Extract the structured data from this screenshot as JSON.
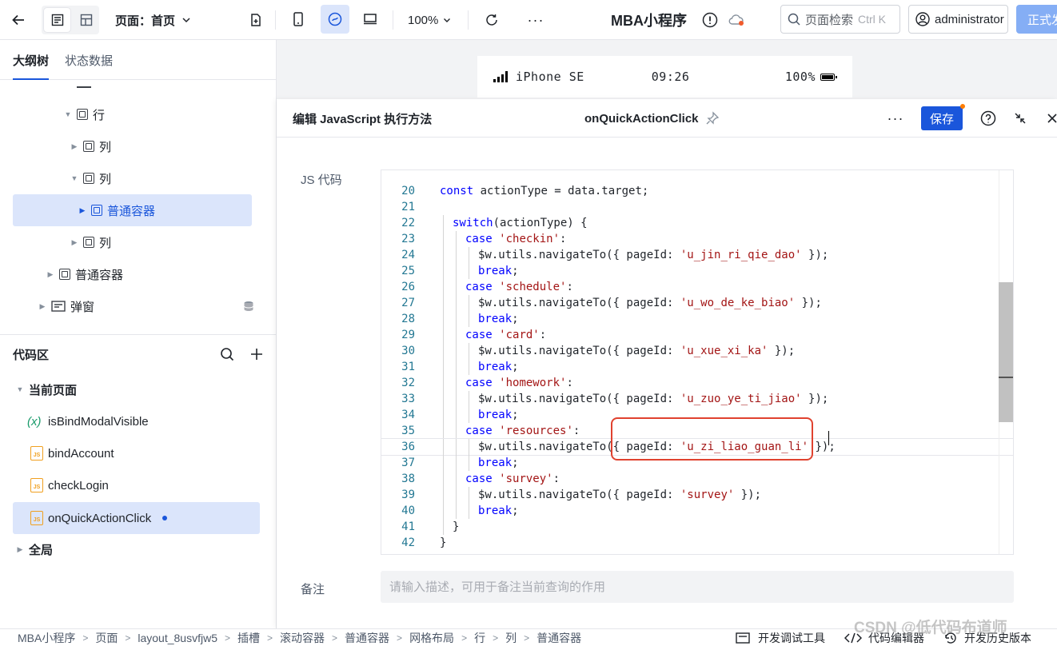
{
  "topbar": {
    "page_selector": "页面：首页",
    "zoom": "100%",
    "app_title": "MBA小程序",
    "search_label": "页面检索",
    "search_shortcut": "Ctrl K",
    "user": "administrator",
    "publish_label": "正式发"
  },
  "left_panel": {
    "tabs": [
      "大纲树",
      "状态数据"
    ],
    "tree": [
      {
        "label": "行"
      },
      {
        "label": "列"
      },
      {
        "label": "列"
      },
      {
        "label": "普通容器"
      },
      {
        "label": "列"
      },
      {
        "label": "普通容器"
      },
      {
        "label": "弹窗"
      }
    ],
    "code_area_title": "代码区",
    "current_page_label": "当前页面",
    "code_items": [
      "isBindModalVisible",
      "bindAccount",
      "checkLogin",
      "onQuickActionClick"
    ],
    "global_label": "全局"
  },
  "phone": {
    "device": "iPhone SE",
    "time": "09:26",
    "battery": "100%"
  },
  "editor": {
    "title": "编辑 JavaScript 执行方法",
    "function_name": "onQuickActionClick",
    "save_label": "保存",
    "code_label": "JS 代码",
    "note_label": "备注",
    "note_placeholder": "请输入描述，可用于备注当前查询的作用",
    "code": [
      {
        "n": "20",
        "indent": 0,
        "html": "<span class=\"kw\">const</span> actionType = data.target;"
      },
      {
        "n": "21",
        "indent": 0,
        "html": ""
      },
      {
        "n": "22",
        "indent": 1,
        "html": "<span class=\"kw\">switch</span>(actionType) {"
      },
      {
        "n": "23",
        "indent": 2,
        "html": "<span class=\"kw\">case</span> <span class=\"str\">'checkin'</span>:"
      },
      {
        "n": "24",
        "indent": 3,
        "html": "$w.utils.navigateTo({ pageId: <span class=\"str\">'u_jin_ri_qie_dao'</span> });"
      },
      {
        "n": "25",
        "indent": 3,
        "html": "<span class=\"kw\">break</span>;"
      },
      {
        "n": "26",
        "indent": 2,
        "html": "<span class=\"kw\">case</span> <span class=\"str\">'schedule'</span>:"
      },
      {
        "n": "27",
        "indent": 3,
        "html": "$w.utils.navigateTo({ pageId: <span class=\"str\">'u_wo_de_ke_biao'</span> });"
      },
      {
        "n": "28",
        "indent": 3,
        "html": "<span class=\"kw\">break</span>;"
      },
      {
        "n": "29",
        "indent": 2,
        "html": "<span class=\"kw\">case</span> <span class=\"str\">'card'</span>:"
      },
      {
        "n": "30",
        "indent": 3,
        "html": "$w.utils.navigateTo({ pageId: <span class=\"str\">'u_xue_xi_ka'</span> });"
      },
      {
        "n": "31",
        "indent": 3,
        "html": "<span class=\"kw\">break</span>;"
      },
      {
        "n": "32",
        "indent": 2,
        "html": "<span class=\"kw\">case</span> <span class=\"str\">'homework'</span>:"
      },
      {
        "n": "33",
        "indent": 3,
        "html": "$w.utils.navigateTo({ pageId: <span class=\"str\">'u_zuo_ye_ti_jiao'</span> });"
      },
      {
        "n": "34",
        "indent": 3,
        "html": "<span class=\"kw\">break</span>;"
      },
      {
        "n": "35",
        "indent": 2,
        "html": "<span class=\"kw\">case</span> <span class=\"str\">'resources'</span>:"
      },
      {
        "n": "36",
        "indent": 3,
        "html": "$w.utils.navigateTo({ pageId: <span class=\"str\">'u_zi_liao_guan_li'</span> });",
        "active": true
      },
      {
        "n": "37",
        "indent": 3,
        "html": "<span class=\"kw\">break</span>;"
      },
      {
        "n": "38",
        "indent": 2,
        "html": "<span class=\"kw\">case</span> <span class=\"str\">'survey'</span>:"
      },
      {
        "n": "39",
        "indent": 3,
        "html": "$w.utils.navigateTo({ pageId: <span class=\"str\">'survey'</span> });"
      },
      {
        "n": "40",
        "indent": 3,
        "html": "<span class=\"kw\">break</span>;"
      },
      {
        "n": "41",
        "indent": 1,
        "html": "}"
      },
      {
        "n": "42",
        "indent": 0,
        "html": "}"
      }
    ]
  },
  "statusbar": {
    "breadcrumbs": [
      "MBA小程序",
      "页面",
      "layout_8usvfjw5",
      "插槽",
      "滚动容器",
      "普通容器",
      "网格布局",
      "行",
      "列",
      "普通容器"
    ],
    "tools": [
      "开发调试工具",
      "代码编辑器",
      "开发历史版本"
    ]
  },
  "watermark": "CSDN @低代码布道师",
  "colors": {
    "accent": "#1a56db",
    "highlight_box": "#e0422f"
  }
}
